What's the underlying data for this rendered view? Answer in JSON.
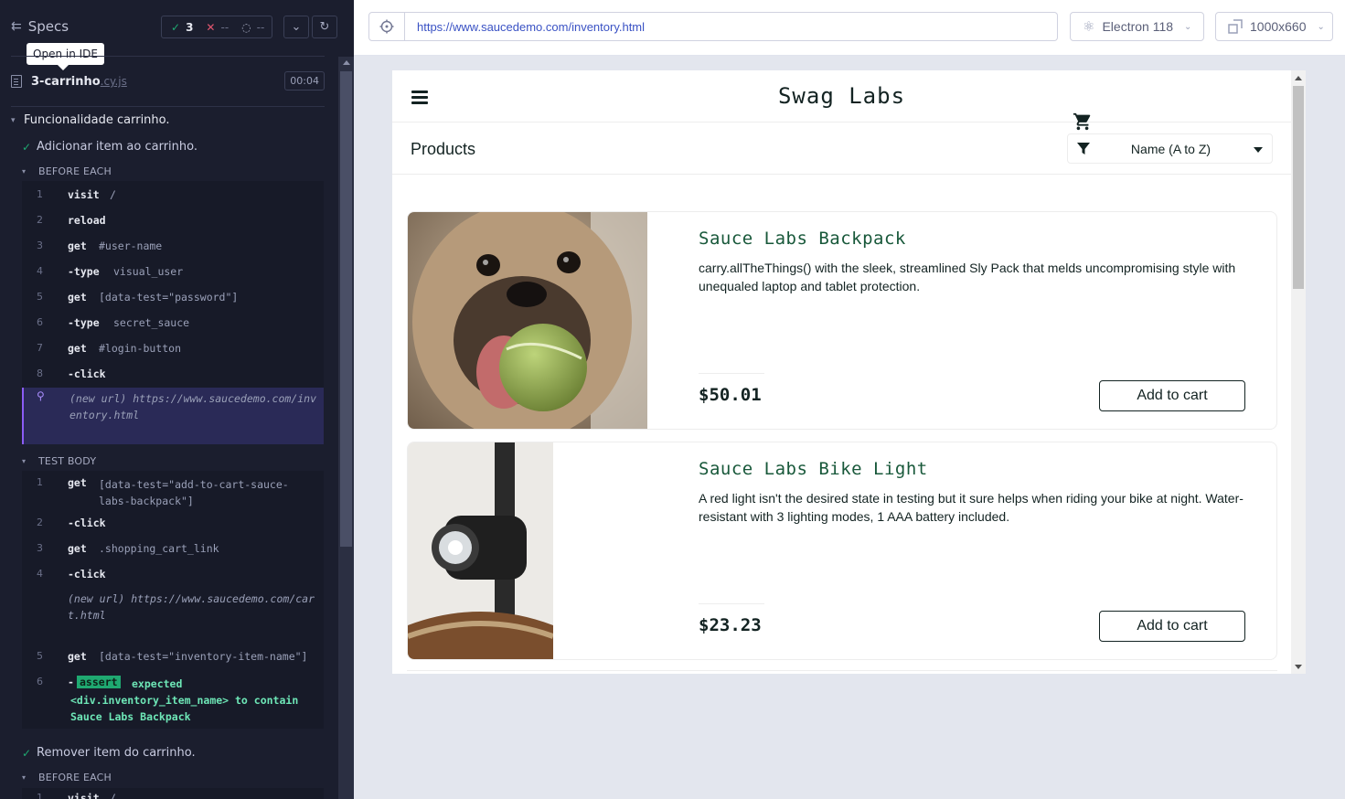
{
  "reporter": {
    "specs_label": "Specs",
    "tooltip": "Open in IDE",
    "stats": {
      "passed": "3",
      "failed": "--",
      "pending": "--"
    },
    "file": {
      "name": "3-carrinho",
      "ext": ".cy.js",
      "duration": "00:04"
    },
    "suite": "Funcionalidade carrinho.",
    "test1": "Adicionar item ao carrinho.",
    "before_each": "BEFORE EACH",
    "test_body": "TEST BODY",
    "before_cmds": [
      {
        "n": "1",
        "name": "visit",
        "msg": "/"
      },
      {
        "n": "2",
        "name": "reload",
        "msg": ""
      },
      {
        "n": "3",
        "name": "get",
        "msg": "#user-name"
      },
      {
        "n": "4",
        "name": "-type",
        "msg": "visual_user"
      },
      {
        "n": "5",
        "name": "get",
        "msg": "[data-test=\"password\"]"
      },
      {
        "n": "6",
        "name": "-type",
        "msg": "secret_sauce"
      },
      {
        "n": "7",
        "name": "get",
        "msg": "#login-button"
      },
      {
        "n": "8",
        "name": "-click",
        "msg": ""
      }
    ],
    "new_url_1": "(new url) https://www.saucedemo.com/inventory.html",
    "body_cmds": [
      {
        "n": "1",
        "name": "get",
        "msg": "[data-test=\"add-to-cart-sauce-labs-backpack\"]"
      },
      {
        "n": "2",
        "name": "-click",
        "msg": ""
      },
      {
        "n": "3",
        "name": "get",
        "msg": ".shopping_cart_link"
      },
      {
        "n": "4",
        "name": "-click",
        "msg": ""
      }
    ],
    "new_url_2": "(new url) https://www.saucedemo.com/cart.html",
    "body_cmd5": {
      "n": "5",
      "name": "get",
      "msg": "[data-test=\"inventory-item-name\"]"
    },
    "body_cmd6": {
      "n": "6",
      "badge": "assert",
      "msg1": "expected",
      "msg2": "<div.inventory_item_name> to contain",
      "msg3": "Sauce Labs Backpack"
    },
    "test2": "Remover item do carrinho.",
    "before_each_2": "BEFORE EACH",
    "partial_cmd": {
      "n": "1",
      "name": "visit",
      "msg": "/"
    }
  },
  "topbar": {
    "url": "https://www.saucedemo.com/inventory.html",
    "browser": "Electron 118",
    "viewport": "1000x660"
  },
  "aut": {
    "logo": "Swag Labs",
    "products_title": "Products",
    "sort_value": "Name (A to Z)",
    "items": [
      {
        "name": "Sauce Labs Backpack",
        "desc": "carry.allTheThings() with the sleek, streamlined Sly Pack that melds uncompromising style with unequaled laptop and tablet protection.",
        "price": "$50.01",
        "button": "Add to cart"
      },
      {
        "name": "Sauce Labs Bike Light",
        "desc": "A red light isn't the desired state in testing but it sure helps when riding your bike at night. Water-resistant with 3 lighting modes, 1 AAA battery included.",
        "price": "$23.23",
        "button": "Add to cart"
      }
    ]
  }
}
